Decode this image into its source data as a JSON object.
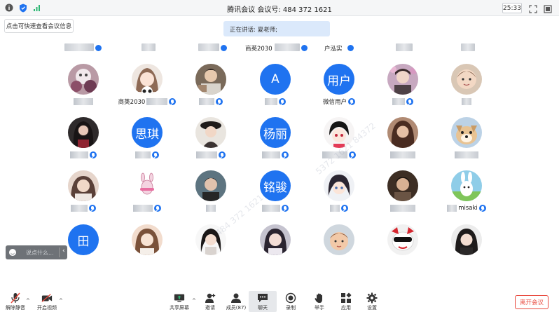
{
  "titlebar": {
    "title": "腾讯会议 会议号: 484 372 1621",
    "timer": "25:33"
  },
  "info_button": "点击可快速查看会议信息",
  "speaker_banner": "正在讲话: 夏老师;",
  "top_row": {
    "name_a": "商英2030",
    "name_b": "户泓实"
  },
  "tiles": {
    "r1c2": "商英2030",
    "r1c4": "A",
    "r1c5_letter": "用户",
    "r1c5_name": "微信用户",
    "r2c2": "思琪",
    "r2c4": "杨丽",
    "r3c4": "铭骏",
    "r3c7_name": "misaki",
    "r4c1": "田"
  },
  "chat": {
    "placeholder": "说点什么..."
  },
  "toolbar": {
    "unmute": "解除静音",
    "start_video": "开启视频",
    "share_screen": "共享屏幕",
    "invite": "邀请",
    "members": "成员(87)",
    "chat": "聊天",
    "record": "录制",
    "raise_hand": "举手",
    "apps": "应用",
    "settings": "设置",
    "leave": "离开会议"
  },
  "colors": {
    "accent": "#1f73f0",
    "leave": "#e8483c",
    "banner": "#dbe9fb"
  }
}
